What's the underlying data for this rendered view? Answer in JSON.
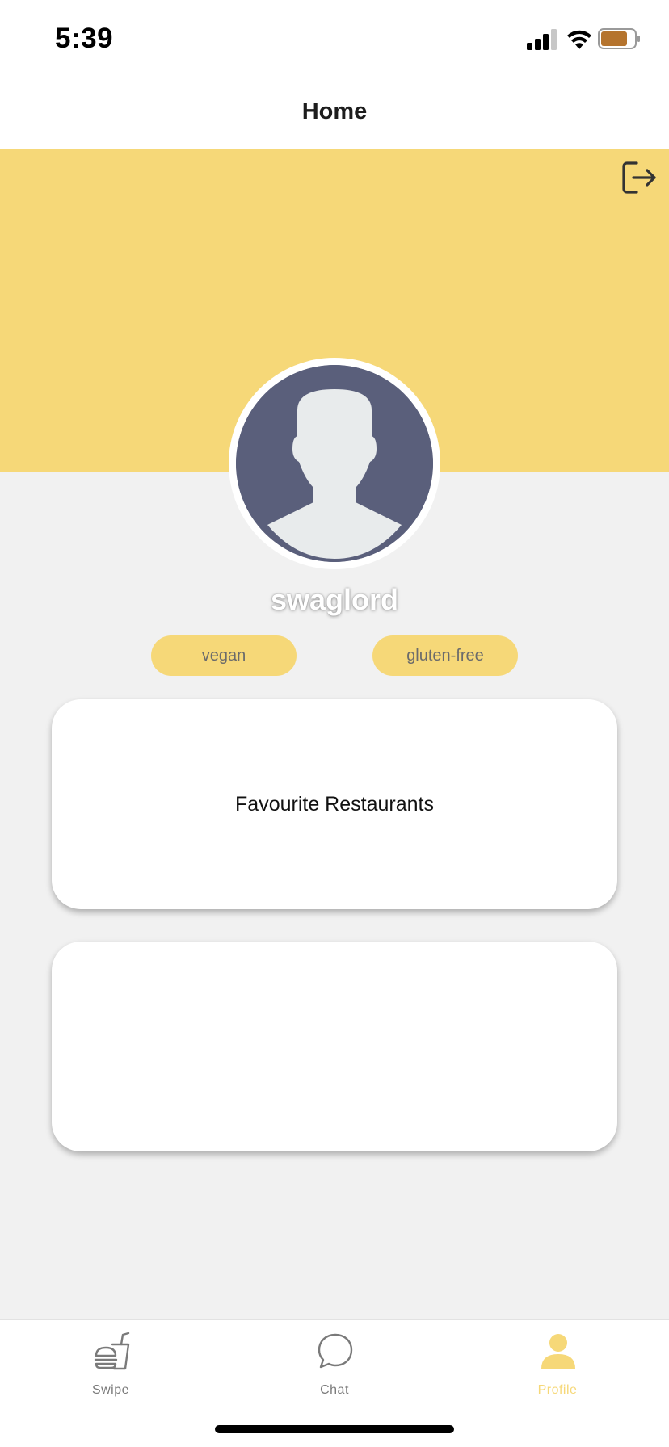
{
  "status_bar": {
    "time": "5:39",
    "icons": [
      "cellular-signal-icon",
      "wifi-icon",
      "battery-icon"
    ],
    "battery_color": "#b5742e"
  },
  "header": {
    "title": "Home"
  },
  "banner": {
    "color": "#f6d878",
    "logout_icon": "logout-icon"
  },
  "profile": {
    "username": "swaglord",
    "avatar_icon": "default-avatar-icon",
    "tags": [
      "vegan",
      "gluten-free"
    ]
  },
  "cards": [
    {
      "title": "Favourite Restaurants"
    },
    {
      "title": ""
    }
  ],
  "tab_bar": {
    "tabs": [
      {
        "label": "Swipe",
        "icon": "burger-drink-icon",
        "active": false
      },
      {
        "label": "Chat",
        "icon": "chat-bubble-icon",
        "active": false
      },
      {
        "label": "Profile",
        "icon": "person-icon",
        "active": true
      }
    ],
    "active_color": "#f6d878",
    "inactive_color": "#7a7a7a"
  }
}
